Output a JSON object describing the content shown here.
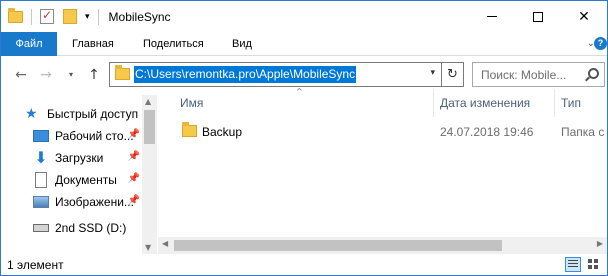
{
  "window": {
    "title": "MobileSync"
  },
  "ribbon": {
    "tabs": [
      {
        "label": "Файл"
      },
      {
        "label": "Главная"
      },
      {
        "label": "Поделиться"
      },
      {
        "label": "Вид"
      }
    ],
    "help_label": "?"
  },
  "address": {
    "path": "C:\\Users\\remontka.pro\\Apple\\MobileSync"
  },
  "search": {
    "placeholder": "Поиск: Mobile..."
  },
  "navpane": {
    "items": [
      {
        "label": "Быстрый доступ",
        "icon": "star-icon",
        "pinned": false
      },
      {
        "label": "Рабочий сто...",
        "icon": "desktop-icon",
        "pinned": true
      },
      {
        "label": "Загрузки",
        "icon": "downloads-icon",
        "pinned": true
      },
      {
        "label": "Документы",
        "icon": "documents-icon",
        "pinned": true
      },
      {
        "label": "Изображени...",
        "icon": "pictures-icon",
        "pinned": true
      },
      {
        "label": "2nd SSD (D:)",
        "icon": "drive-icon",
        "pinned": false
      }
    ]
  },
  "content": {
    "columns": [
      "Имя",
      "Дата изменения",
      "Тип"
    ],
    "rows": [
      {
        "name": "Backup",
        "date": "24.07.2018 19:46",
        "type": "Папка с ф"
      }
    ]
  },
  "status": {
    "text": "1 элемент"
  },
  "colors": {
    "accent": "#1979ca",
    "selection": "#0078d7",
    "folder": "#f6c94b"
  }
}
